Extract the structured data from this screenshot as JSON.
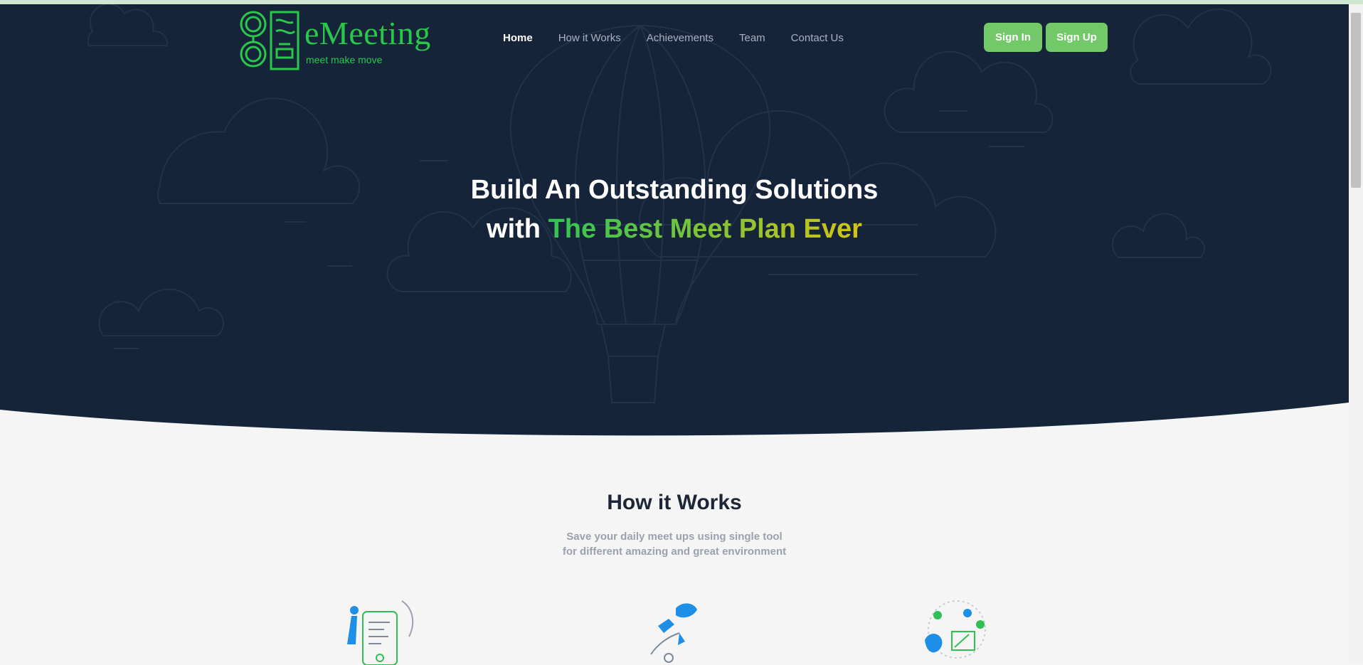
{
  "brand": {
    "name": "eMeeting",
    "tagline": "meet make move",
    "color": "#29c84a"
  },
  "nav": {
    "items": [
      {
        "label": "Home",
        "active": true
      },
      {
        "label": "How it Works",
        "active": false
      },
      {
        "label": "Achievements",
        "active": false
      },
      {
        "label": "Team",
        "active": false
      },
      {
        "label": "Contact Us",
        "active": false
      }
    ]
  },
  "auth": {
    "signin_label": "Sign In",
    "signup_label": "Sign Up",
    "button_color": "#73c96a"
  },
  "hero": {
    "line1": "Build An Outstanding Solutions",
    "line2_prefix": "with",
    "line2_highlight": "The Best Meet Plan Ever",
    "background_color": "#16243a",
    "gradient": [
      "#2fc553",
      "#7ec43a",
      "#d6c413"
    ]
  },
  "how_it_works": {
    "title": "How it Works",
    "subtitle_line1": "Save your daily meet ups using single tool",
    "subtitle_line2": "for different amazing and great environment",
    "illustrations": [
      "phone-checklist-illustration",
      "rocket-person-illustration",
      "design-team-illustration"
    ]
  }
}
